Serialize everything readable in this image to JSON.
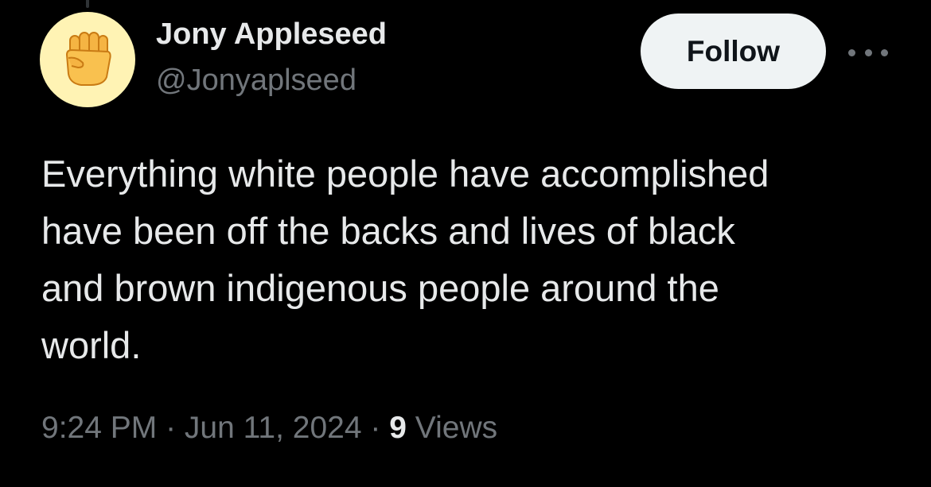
{
  "author": {
    "display_name": "Jony Appleseed",
    "handle": "@Jonyaplseed",
    "avatar_icon": "raised-fist-emoji-icon",
    "avatar_bg": "#fff3b4"
  },
  "actions": {
    "follow_label": "Follow",
    "more_icon": "more-horizontal-icon"
  },
  "tweet": {
    "lines": [
      "Everything white people have accomplished",
      "have been off the backs and lives of black",
      "and brown indigenous people around the",
      "world."
    ]
  },
  "meta": {
    "time": "9:24 PM",
    "separator": " · ",
    "date": "Jun 11, 2024",
    "views_count": "9",
    "views_label": "Views"
  },
  "colors": {
    "background": "#000000",
    "primary_text": "#e7e9ea",
    "secondary_text": "#71767b",
    "button_bg": "#eff3f4",
    "button_text": "#0f1419"
  }
}
